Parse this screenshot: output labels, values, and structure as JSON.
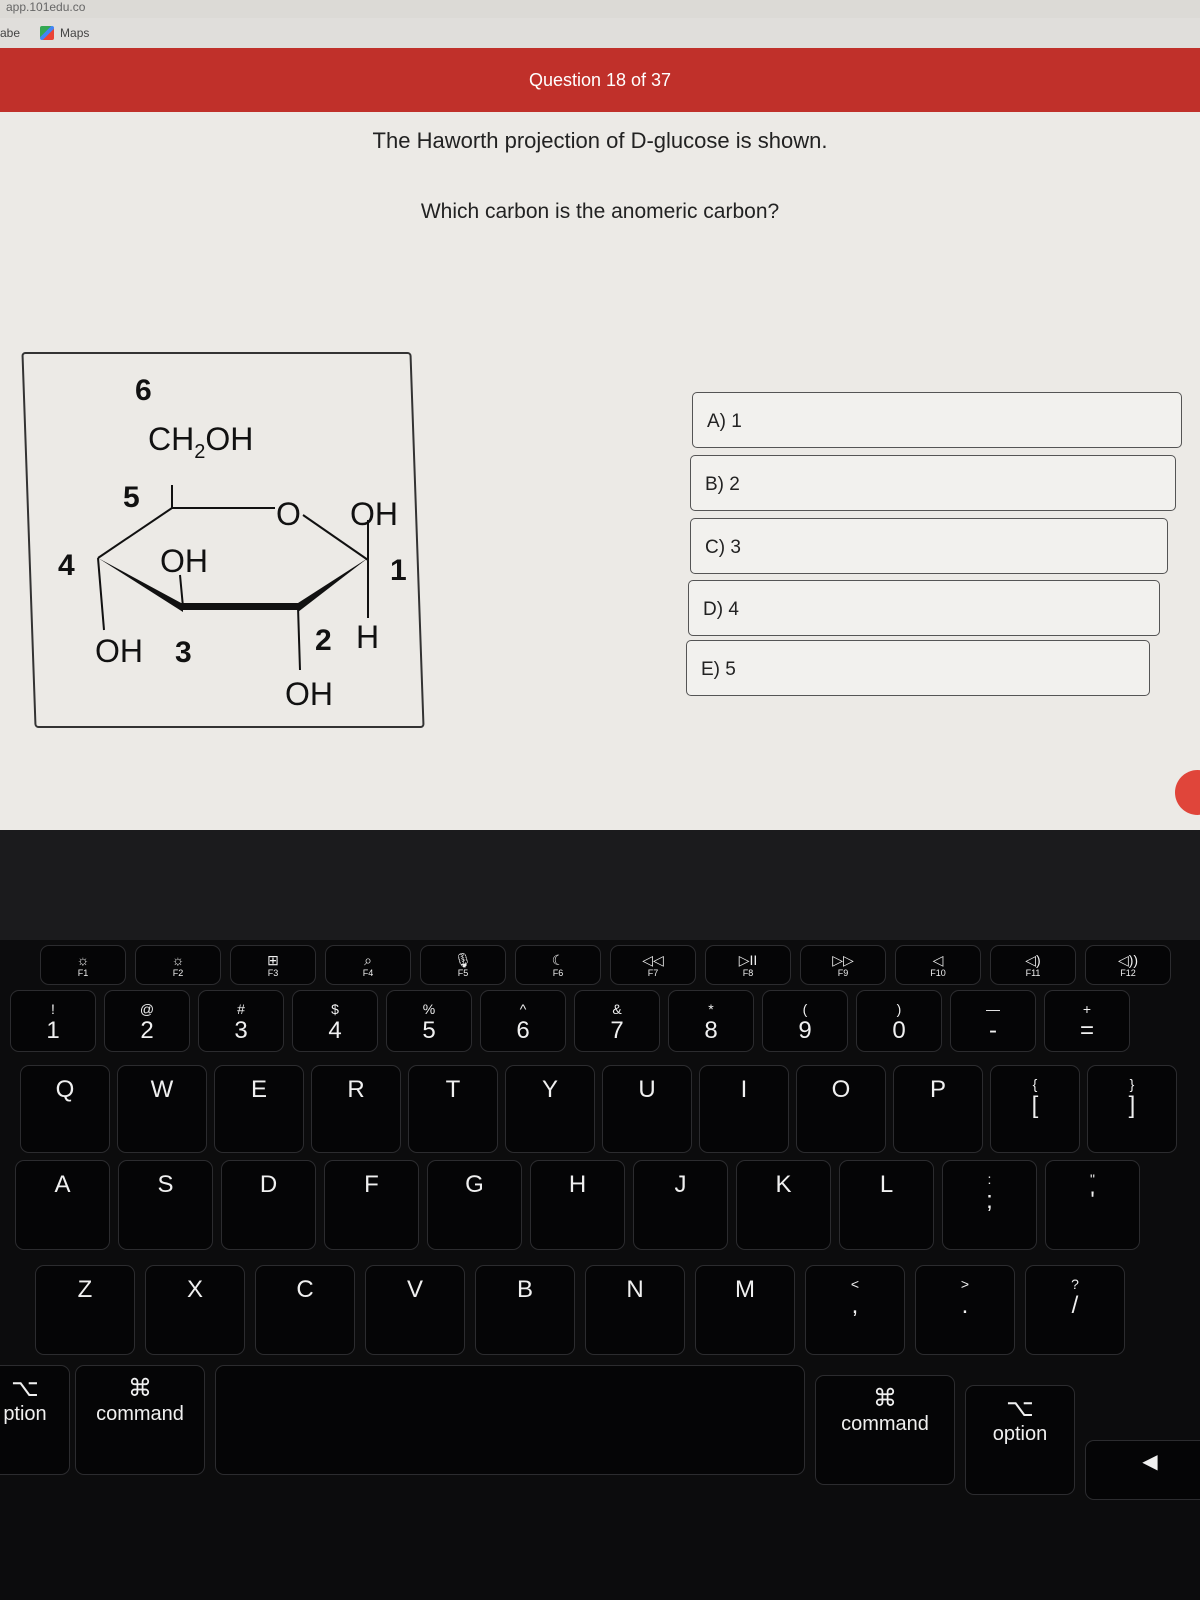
{
  "browser": {
    "url_fragment": "app.101edu.co",
    "bookmarks": [
      {
        "label": "abe"
      },
      {
        "label": "Maps",
        "icon": "maps-icon"
      }
    ]
  },
  "header": {
    "title": "Question 18 of 37",
    "color": "#c0302a"
  },
  "question": {
    "line1": "The Haworth projection of D-glucose is shown.",
    "line2": "Which carbon is the anomeric carbon?"
  },
  "molecule": {
    "labels": {
      "c6": "6",
      "ch2oh": "CH",
      "sub2": "2",
      "oh_suffix": "OH",
      "c5": "5",
      "o": "O",
      "oh1": "OH",
      "c1": "1",
      "c4": "4",
      "oh3_top": "OH",
      "oh4": "OH",
      "c3": "3",
      "c2": "2",
      "h": "H",
      "oh2": "OH"
    }
  },
  "answers": [
    {
      "label": "A) 1"
    },
    {
      "label": "B) 2"
    },
    {
      "label": "C) 3"
    },
    {
      "label": "D) 4"
    },
    {
      "label": "E) 5"
    }
  ],
  "keyboard": {
    "fn": [
      [
        "☼",
        "F1"
      ],
      [
        "☼",
        "F2"
      ],
      [
        "⊞",
        "F3"
      ],
      [
        "⌕",
        "F4"
      ],
      [
        "🎙",
        "F5"
      ],
      [
        "☾",
        "F6"
      ],
      [
        "◁◁",
        "F7"
      ],
      [
        "▷II",
        "F8"
      ],
      [
        "▷▷",
        "F9"
      ],
      [
        "◁",
        "F10"
      ],
      [
        "◁)",
        "F11"
      ],
      [
        "◁))",
        "F12"
      ]
    ],
    "num": [
      [
        "!",
        "1"
      ],
      [
        "@",
        "2"
      ],
      [
        "#",
        "3"
      ],
      [
        "$",
        "4"
      ],
      [
        "%",
        "5"
      ],
      [
        "^",
        "6"
      ],
      [
        "&",
        "7"
      ],
      [
        "*",
        "8"
      ],
      [
        "(",
        "9"
      ],
      [
        ")",
        "0"
      ],
      [
        "—",
        "-"
      ],
      [
        "+",
        "="
      ]
    ],
    "row1": [
      [
        "",
        "Q"
      ],
      [
        "",
        "W"
      ],
      [
        "",
        "E"
      ],
      [
        "",
        "R"
      ],
      [
        "",
        "T"
      ],
      [
        "",
        "Y"
      ],
      [
        "",
        "U"
      ],
      [
        "",
        "I"
      ],
      [
        "",
        "O"
      ],
      [
        "",
        "P"
      ],
      [
        "{",
        "["
      ],
      [
        "}",
        "]"
      ]
    ],
    "row2": [
      [
        "",
        "A"
      ],
      [
        "",
        "S"
      ],
      [
        "",
        "D"
      ],
      [
        "",
        "F"
      ],
      [
        "",
        "G"
      ],
      [
        "",
        "H"
      ],
      [
        "",
        "J"
      ],
      [
        "",
        "K"
      ],
      [
        "",
        "L"
      ],
      [
        ":",
        ";"
      ],
      [
        "\"",
        "'"
      ]
    ],
    "row3": [
      [
        "",
        "Z"
      ],
      [
        "",
        "X"
      ],
      [
        "",
        "C"
      ],
      [
        "",
        "V"
      ],
      [
        "",
        "B"
      ],
      [
        "",
        "N"
      ],
      [
        "",
        "M"
      ],
      [
        "<",
        ","
      ],
      [
        ">",
        "."
      ],
      [
        "?",
        "/"
      ]
    ],
    "bottom": {
      "left_option": "ption",
      "left_option_symbol": "⌥",
      "left_command": "command",
      "left_command_symbol": "⌘",
      "right_command": "command",
      "right_command_symbol": "⌘",
      "right_option": "option",
      "right_option_symbol": "⌥",
      "arrow": "◀"
    }
  }
}
